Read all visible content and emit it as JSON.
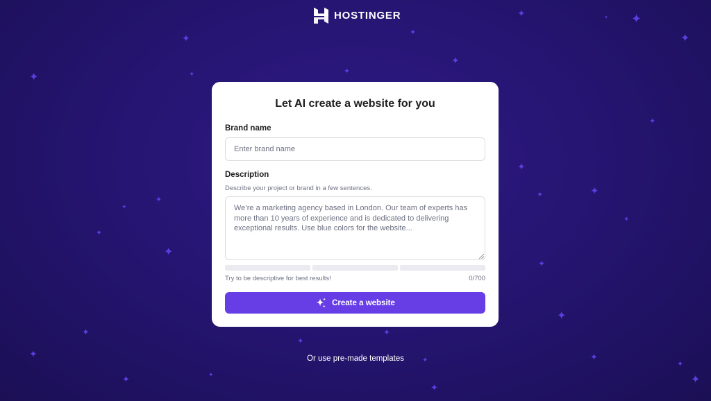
{
  "brand": {
    "name": "HOSTINGER"
  },
  "card": {
    "title": "Let AI create a website for you",
    "brand_label": "Brand name",
    "brand_placeholder": "Enter brand name",
    "description_label": "Description",
    "description_hint": "Describe your project or brand in a few sentences.",
    "description_placeholder": "We’re a marketing agency based in London. Our team of experts has more than 10 years of experience and is dedicated to delivering exceptional results. Use blue colors for the website...",
    "quality_meter": {
      "segments": 3,
      "filled": 0
    },
    "tip": "Try to be descriptive for best results!",
    "counter": "0/700",
    "create_button": "Create a website",
    "create_icon": "sparkles-icon"
  },
  "footer": {
    "templates_link": "Or use pre-made templates"
  },
  "colors": {
    "background": "#24146e",
    "accent": "#673de6",
    "star": "#5a3ee0",
    "card": "#ffffff"
  }
}
